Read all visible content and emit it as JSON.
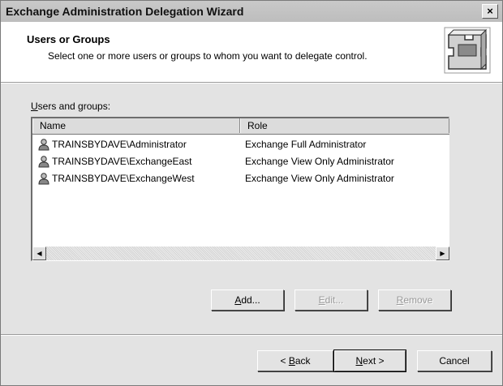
{
  "window": {
    "title": "Exchange Administration Delegation Wizard",
    "close_glyph": "×"
  },
  "header": {
    "title": "Users or Groups",
    "subtitle": "Select one or more users or groups to whom you want to delegate control."
  },
  "list": {
    "label_u": "U",
    "label_rest": "sers and groups:",
    "columns": {
      "name": "Name",
      "role": "Role"
    },
    "rows": [
      {
        "name": "TRAINSBYDAVE\\Administrator",
        "role": "Exchange Full Administrator"
      },
      {
        "name": "TRAINSBYDAVE\\ExchangeEast",
        "role": "Exchange View Only Administrator"
      },
      {
        "name": "TRAINSBYDAVE\\ExchangeWest",
        "role": "Exchange View Only Administrator"
      }
    ]
  },
  "buttons": {
    "add_u": "A",
    "add_rest": "dd...",
    "edit_u": "E",
    "edit_rest": "dit...",
    "remove_u": "R",
    "remove_rest": "emove",
    "back_pre": "< ",
    "back_u": "B",
    "back_rest": "ack",
    "next_u": "N",
    "next_rest": "ext >",
    "cancel": "Cancel"
  },
  "icons": {
    "user": "user-icon",
    "wizard": "wizard-puzzle-icon",
    "scroll_left": "◀",
    "scroll_right": "▶"
  }
}
